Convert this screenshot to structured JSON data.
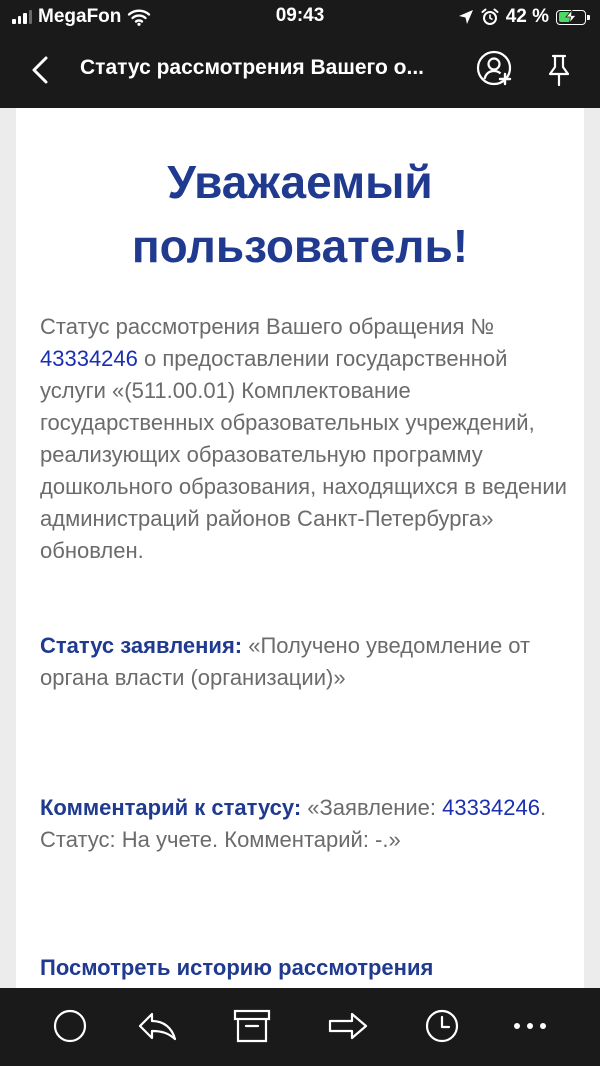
{
  "status_bar": {
    "carrier": "MegaFon",
    "time": "09:43",
    "battery_percent": "42 %",
    "battery_level": 0.42,
    "icons": [
      "signal-icon",
      "wifi-icon",
      "location-icon",
      "alarm-icon",
      "battery-icon"
    ]
  },
  "nav": {
    "title": "Статус рассмотрения Вашего о...",
    "icons": [
      "chevron-left-icon",
      "add-contact-icon",
      "pin-icon"
    ]
  },
  "email": {
    "greeting_line1": "Уважаемый",
    "greeting_line2": "пользователь!",
    "intro_before": "Статус рассмотрения Вашего обращения № ",
    "request_number": "43334246",
    "intro_after": " о предоставлении государственной услуги «(511.00.01) Комплектование государственных образовательных учреждений, реализующих образовательную программу дошкольного образования, находящихся в ведении администраций районов Санкт-Петербурга» обновлен.",
    "status_label": "Статус заявления:",
    "status_value": " «Получено уведомление от органа власти (организации)»",
    "comment_label": "Комментарий к статусу:",
    "comment_before": " «Заявление: ",
    "comment_number": "43334246",
    "comment_after": ". Статус: На учете. Комментарий: -.»",
    "history_link": "Посмотреть историю рассмотрения"
  },
  "toolbar": {
    "icons": [
      "circle-icon",
      "reply-icon",
      "archive-icon",
      "forward-icon",
      "clock-icon",
      "more-icon"
    ]
  },
  "colors": {
    "bar_background": "#1a1a1a",
    "heading_blue": "#1f3a8f",
    "link_blue": "#1a2fb0",
    "body_gray": "#6b6b6b",
    "battery_green": "#4cd964"
  }
}
